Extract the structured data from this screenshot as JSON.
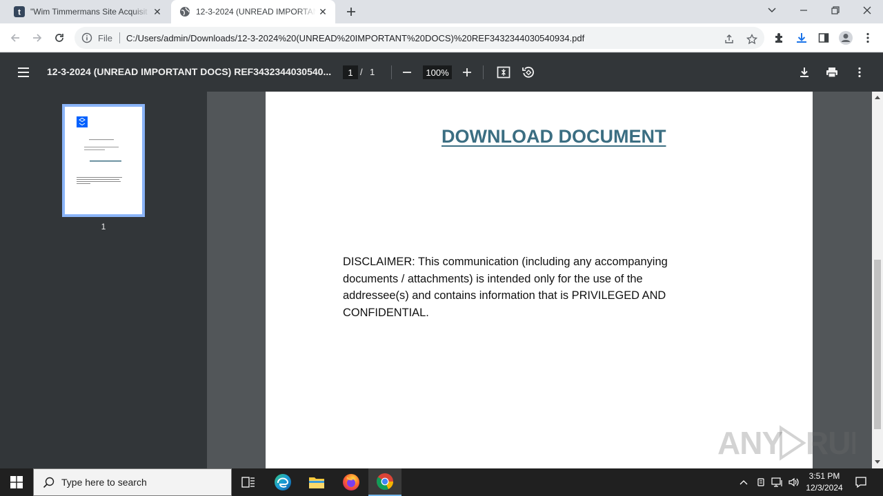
{
  "browser": {
    "tabs": [
      {
        "title": "\"Wim Timmermans Site Acquisit",
        "favicon": "tumblr-icon"
      },
      {
        "title": "12-3-2024 (UNREAD IMPORTANT",
        "favicon": "globe-icon"
      }
    ],
    "address": {
      "scheme_label": "File",
      "url": "C:/Users/admin/Downloads/12-3-2024%20(UNREAD%20IMPORTANT%20DOCS)%20REF3432344030540934.pdf"
    }
  },
  "pdf_toolbar": {
    "title": "12-3-2024 (UNREAD IMPORTANT DOCS) REF3432344030540...",
    "current_page": "1",
    "page_separator": "/",
    "total_pages": "1",
    "zoom": "100%"
  },
  "sidebar": {
    "thumbnail_label": "1"
  },
  "document": {
    "link_text": "DOWNLOAD DOCUMENT",
    "disclaimer": "DISCLAIMER: This communication (including any accompanying documents / attachments) is intended only for the use of the addressee(s) and contains information that is PRIVILEGED AND CONFIDENTIAL."
  },
  "watermark": "ANY RUN",
  "taskbar": {
    "search_placeholder": "Type here to search",
    "time": "3:51 PM",
    "date": "12/3/2024"
  },
  "colors": {
    "link": "#3b6e82",
    "pdf_toolbar": "#323639",
    "viewer_bg": "#525659"
  }
}
